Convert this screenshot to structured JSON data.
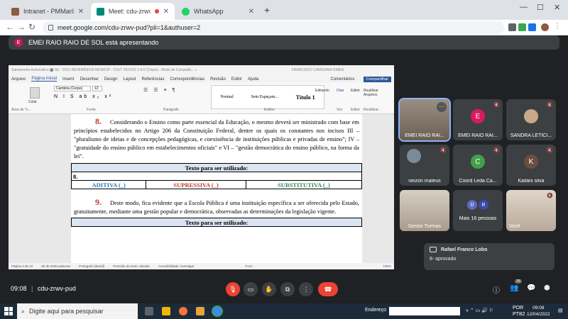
{
  "browser": {
    "tabs": [
      {
        "title": "Intranet - PMMarília",
        "color": "#8e5b3c"
      },
      {
        "title": "Meet: cdu-zrwv-pud",
        "color": "#00897b"
      },
      {
        "title": "WhatsApp",
        "color": "#25d366"
      }
    ],
    "url": "meet.google.com/cdu-zrwv-pud?pli=1&authuser=2",
    "new_tab": "+",
    "minimize": "—",
    "maximize": "☐",
    "close": "✕"
  },
  "meet": {
    "presenter_banner": "EMEI RAIO RAIO DE SOL está apresentando",
    "presenter_initial": "E",
    "meeting_time": "09:08",
    "meeting_code": "cdu-zrwv-pud",
    "participants_count": "26",
    "toast": {
      "sender": "Rafael Franco Lobo",
      "message": "8- aprovado"
    },
    "tiles": [
      {
        "name": "EMEI RAIO RAI...",
        "type": "video"
      },
      {
        "name": "EMEI RAIO RAI...",
        "type": "initial",
        "initial": "E",
        "color": "#d81b60"
      },
      {
        "name": "SANDRA LETICI...",
        "type": "photo"
      },
      {
        "name": "",
        "type": "photo"
      },
      {
        "name": "neizon mateus",
        "type": "photo"
      },
      {
        "name": "Coord Leda Ca...",
        "type": "initial",
        "initial": "C",
        "color": "#43a047"
      },
      {
        "name": "Kailani silva",
        "type": "initial",
        "initial": "K",
        "color": "#6d4c41"
      },
      {
        "name": "Gestor Turmas",
        "type": "video"
      },
      {
        "name": "Mais 16 pessoas",
        "type": "group",
        "initial": "D",
        "initial2": "R"
      },
      {
        "name": "Você",
        "type": "video"
      }
    ]
  },
  "word": {
    "title_bar": "Salvamento Automático   ⬤   SE - DOC REFERÊNCIA MUNICIP - COLT 2021/22 1-6-II (Cópia) - Modo de Compatib...   ⌕",
    "user_name": "FRANCISCO CAVEDIANI EMEIE",
    "menu": [
      "Arquivo",
      "Página Inicial",
      "Inserir",
      "Desenhar",
      "Design",
      "Layout",
      "Referências",
      "Correspondências",
      "Revisão",
      "Exibir",
      "Ajuda"
    ],
    "comments_label": "Comentários",
    "share_label": "Compartilhar",
    "font_name": "Cambria (Corpo)",
    "font_size": "12",
    "styles": [
      "Normal",
      "Sem Espaçam...",
      "Título 1"
    ],
    "groups": [
      "Área de Tr...",
      "Fonte",
      "Parágrafo",
      "Estilos",
      "Voz",
      "Editor",
      "Reutilizar..."
    ],
    "ribbon_buttons": [
      "Colar",
      "Editando",
      "Ditar",
      "Editor",
      "Reutilizar Arquivos"
    ],
    "para8_num": "8.",
    "para8_text": "Considerando o Ensino como parte essencial da Educação, o mesmo deverá ser ministrado com base em princípios estabelecidos no Artigo 206 da Constituição Federal, dentre os quais os constantes nos incisos III – \"pluralismo de ideias e de concepções pedagógicas, e coexistência de instituições públicas e privadas de ensino\"; IV – \"gratuidade do ensino público em estabelecimentos oficiais\" e VI – \"gestão democrática do ensino público, na forma da lei\".",
    "table_header": "Texto para ser utilizado:",
    "table_num": "8.",
    "opt_aditiva": "ADITIVA (_)",
    "opt_supressiva": "SUPRESSIVA (_)",
    "opt_substitutiva": "SUBSTITUTIVA (_)",
    "para9_num": "9.",
    "para9_text": "Deste modo, fica evidente que a Escola Pública é uma instituição específica a ser oferecida pelo Estado, gratuitamente, mediante uma gestão popular e democrática, observadas as determinações da legislação vigente.",
    "table2_header": "Texto para ser utilizado:",
    "status": [
      "Página 3 de 10",
      "66 de 2028 palavras",
      "Português (Brasil)",
      "Previsão de texto: ativado",
      "Acessibilidade: investigar",
      "Foco"
    ],
    "zoom": "100%"
  },
  "taskbar": {
    "search_placeholder": "Digite aqui para pesquisar",
    "address_label": "Endereço",
    "lang": "POR",
    "lang2": "PTB2",
    "time": "09:08",
    "date": "12/04/2022"
  }
}
